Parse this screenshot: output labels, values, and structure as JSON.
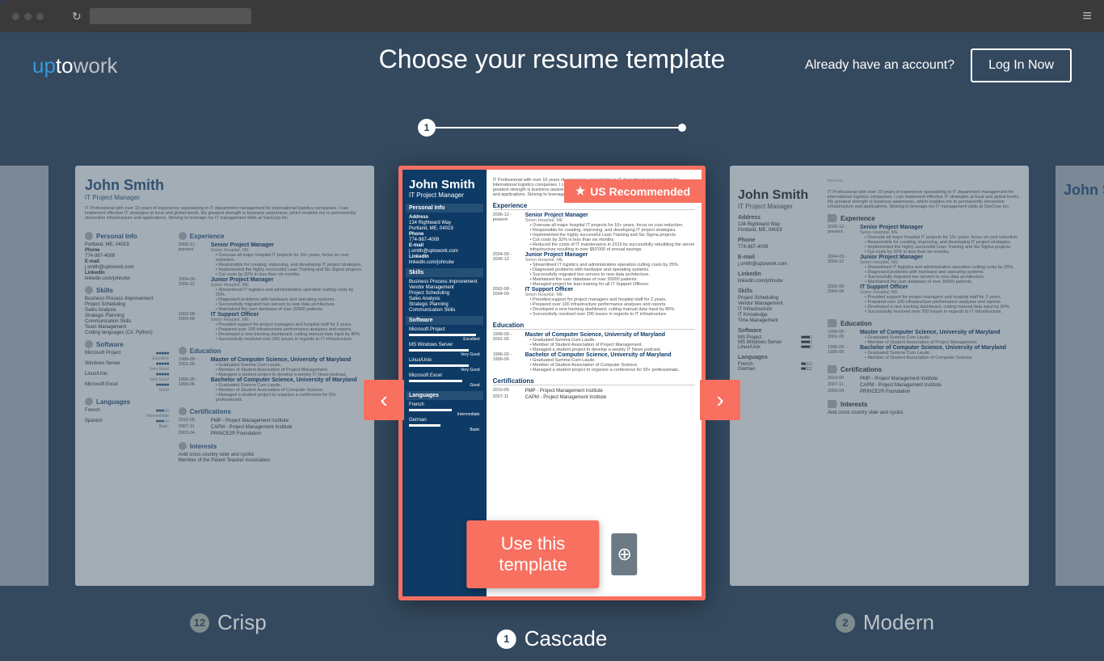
{
  "header": {
    "logo_pre": "up",
    "logo_mid": "to",
    "logo_post": "work",
    "title": "Choose your resume template",
    "account_prompt": "Already have an account?",
    "login_label": "Log In Now"
  },
  "progress": {
    "step": "1"
  },
  "carousel": {
    "prev_icon": "‹",
    "next_icon": "›",
    "badge_text": "US Recommended",
    "use_template_label": "Use this template"
  },
  "labels": {
    "left_num": "12",
    "left_name": "Crisp",
    "center_num": "1",
    "center_name": "Cascade",
    "right_num": "2",
    "right_name": "Modern"
  },
  "resume": {
    "name": "John Smith",
    "title": "IT Project Manager",
    "summary": "IT Professional with over 10 years of experience specializing in IT department management for international logistics companies. I can implement effective IT strategies at local and global levels. My greatest strength is business awareness, which enables me to permanently streamline infrastructure and applications. Striving to leverage my IT management skills at SanCorp Inc.",
    "personal_info_h": "Personal Info",
    "address_h": "Address",
    "address1": "134 Rightward Way",
    "address2": "Portland, ME, 04019",
    "phone_h": "Phone",
    "phone": "774-987-4009",
    "email_h": "E-mail",
    "email": "j.smith@uptowork.com",
    "linkedin_h": "LinkedIn",
    "linkedin": "linkedin.com/johnutw",
    "skills_h": "Skills",
    "skills": [
      "Business Process Improvement",
      "Vendor Management",
      "Project Scheduling",
      "Sales Analysis",
      "Strategic Planning",
      "Communication Skills"
    ],
    "software_h": "Software",
    "software": [
      {
        "name": "Microsoft Project",
        "rating": "Excellent",
        "gap": "5%"
      },
      {
        "name": "MS Windows Server",
        "rating": "Very Good",
        "gap": "15%"
      },
      {
        "name": "Linux/Unix",
        "rating": "Very Good",
        "gap": "15%"
      },
      {
        "name": "Microsoft Excel",
        "rating": "Good",
        "gap": "25%"
      }
    ],
    "languages_h": "Languages",
    "languages": [
      {
        "name": "French",
        "rating": "Intermediate",
        "gap": "40%"
      },
      {
        "name": "German",
        "rating": "Basic",
        "gap": "55%"
      }
    ],
    "experience_h": "Experience",
    "jobs": [
      {
        "dates": "2006-12 - present",
        "title": "Senior Project Manager",
        "company": "Seton Hospital, ME",
        "bullets": [
          "Oversaw all major hospital IT projects for 10+ years, focus on cost reduction.",
          "Responsible for creating, improving, and developing IT project strategies.",
          "Implemented the highly successful Lean Training and Six Sigma projects.",
          "Cut costs by 32% in less than six months.",
          "Reduced the costs of IT maintenance in 2015 by successfully rebuilding the server infrastructure resulting in over $50'000 of annual savings."
        ]
      },
      {
        "dates": "2004-09 - 2006-12",
        "title": "Junior Project Manager",
        "company": "Seton Hospital, ME",
        "bullets": [
          "Streamlined IT logistics and administration operation cutting costs by 25%.",
          "Diagnosed problems with hardware and operating systems.",
          "Successfully migrated two servers to new data architecture.",
          "Maintained the user database of over 30000 patients.",
          "Managed project for lean training for all IT Support Officers."
        ]
      },
      {
        "dates": "2002-08 - 2004-09",
        "title": "IT Support Officer",
        "company": "Seton Hospital, ME",
        "bullets": [
          "Provided support for project managers and hospital staff for 2 years.",
          "Prepared over 100 infrastructure performance analyses and reports.",
          "Developed a new tracking dashboard, cutting manual data input by 80%.",
          "Successfully resolved over 200 issues in regards to IT infrastructure."
        ]
      }
    ],
    "education_h": "Education",
    "education": [
      {
        "dates": "1999-09 - 2001-05",
        "title": "Master of Computer Science, University of Maryland",
        "bullets": [
          "Graduated Summa Cum Laude.",
          "Member of Student Association of Project Management.",
          "Managed a student project to develop a weekly IT News podcast."
        ]
      },
      {
        "dates": "1996-09 - 1999-06",
        "title": "Bachelor of Computer Science, University of Maryland",
        "bullets": [
          "Graduated Summa Cum Laude.",
          "Member of Student Association of Computer Science.",
          "Managed a student project to organize a conference for 50+ professionals."
        ]
      }
    ],
    "certs_h": "Certifications",
    "certs": [
      {
        "dates": "2010-05",
        "title": "PMP - Project Management Institute"
      },
      {
        "dates": "2007-11",
        "title": "CAPM - Project Management Institute"
      },
      {
        "dates": "2003-04",
        "title": "PRINCE2® Foundation"
      }
    ],
    "interests_h": "Interests",
    "interests": [
      "Avid cross country skier and cyclist.",
      "Member of the Parent Teacher Association."
    ]
  },
  "crisp_extra": {
    "skills2": [
      "Business Process Improvement",
      "Project Scheduling",
      "Sales Analysis",
      "Strategic Planning",
      "Communication Skills",
      "Team Management",
      "Coding languages (C#, Python)"
    ],
    "sw_dots": [
      {
        "n": "Microsoft Project",
        "r": "Excellent"
      },
      {
        "n": "Windows Server",
        "r": "Very Good"
      },
      {
        "n": "Linux/Unix",
        "r": "Very Good"
      },
      {
        "n": "Microsoft Excel",
        "r": "Good"
      }
    ],
    "langs": [
      {
        "n": "French",
        "r": "Intermediate"
      },
      {
        "n": "Spanish",
        "r": "Basic"
      }
    ]
  },
  "modern_extra": {
    "resume_label": "Resume",
    "sidebar_sh": [
      "Project Scheduling",
      "Vendor Management",
      "IT Infrastructure",
      "IT Knowledge",
      "Time Management"
    ]
  }
}
